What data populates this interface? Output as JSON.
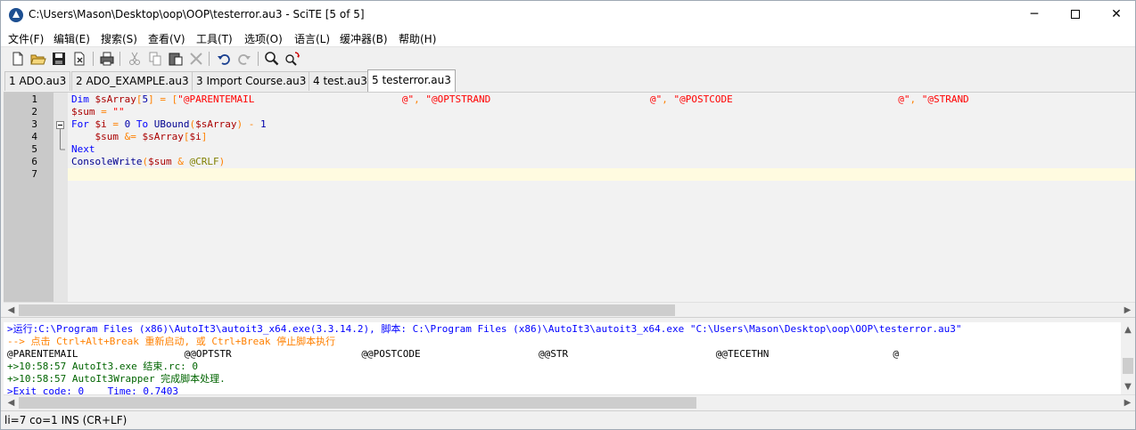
{
  "window": {
    "title": "C:\\Users\\Mason\\Desktop\\oop\\OOP\\testerror.au3 - SciTE [5 of 5]",
    "min_glyph": "─",
    "close_glyph": "✕"
  },
  "menu": [
    "文件(F)",
    "编辑(E)",
    "搜索(S)",
    "查看(V)",
    "工具(T)",
    "选项(O)",
    "语言(L)",
    "缓冲器(B)",
    "帮助(H)"
  ],
  "toolbar": {
    "icons": [
      "new-file-icon",
      "open-folder-icon",
      "save-icon",
      "close-file-icon",
      "print-icon",
      "cut-icon",
      "copy-icon",
      "paste-icon",
      "delete-icon",
      "undo-icon",
      "redo-icon",
      "find-icon",
      "replace-icon"
    ]
  },
  "tabs": [
    {
      "label": "1 ADO.au3",
      "active": false
    },
    {
      "label": "2 ADO_EXAMPLE.au3",
      "active": false
    },
    {
      "label": "3 Import Course.au3",
      "active": false
    },
    {
      "label": "4 test.au3",
      "active": false
    },
    {
      "label": "5 testerror.au3",
      "active": true
    }
  ],
  "editor": {
    "line_numbers": [
      "1",
      "2",
      "3",
      "4",
      "5",
      "6",
      "7"
    ],
    "lines": [
      [
        {
          "t": "Dim ",
          "c": "kw"
        },
        {
          "t": "$sArray",
          "c": "var"
        },
        {
          "t": "[",
          "c": "op"
        },
        {
          "t": "5",
          "c": "num"
        },
        {
          "t": "] = [",
          "c": "op"
        },
        {
          "t": "\"@PARENTEMAIL                         @\"",
          "c": "str"
        },
        {
          "t": ", ",
          "c": "op"
        },
        {
          "t": "\"@OPTSTRAND                           @\"",
          "c": "str"
        },
        {
          "t": ", ",
          "c": "op"
        },
        {
          "t": "\"@POSTCODE                            @\"",
          "c": "str"
        },
        {
          "t": ", ",
          "c": "op"
        },
        {
          "t": "\"@STRAND                              @\"",
          "c": "str"
        },
        {
          "t": ",",
          "c": "op"
        }
      ],
      [
        {
          "t": "$sum",
          "c": "var"
        },
        {
          "t": " = ",
          "c": "op"
        },
        {
          "t": "\"\"",
          "c": "str"
        }
      ],
      [
        {
          "t": "For ",
          "c": "kw"
        },
        {
          "t": "$i",
          "c": "var"
        },
        {
          "t": " = ",
          "c": "op"
        },
        {
          "t": "0",
          "c": "num"
        },
        {
          "t": " To ",
          "c": "kw"
        },
        {
          "t": "UBound",
          "c": "fn"
        },
        {
          "t": "(",
          "c": "op"
        },
        {
          "t": "$sArray",
          "c": "var"
        },
        {
          "t": ") - ",
          "c": "op"
        },
        {
          "t": "1",
          "c": "num"
        }
      ],
      [
        {
          "t": "    ",
          "c": "plain"
        },
        {
          "t": "$sum",
          "c": "var"
        },
        {
          "t": " &= ",
          "c": "op"
        },
        {
          "t": "$sArray",
          "c": "var"
        },
        {
          "t": "[",
          "c": "op"
        },
        {
          "t": "$i",
          "c": "var"
        },
        {
          "t": "]",
          "c": "op"
        }
      ],
      [
        {
          "t": "Next",
          "c": "kw"
        }
      ],
      [
        {
          "t": "ConsoleWrite",
          "c": "fn"
        },
        {
          "t": "(",
          "c": "op"
        },
        {
          "t": "$sum",
          "c": "var"
        },
        {
          "t": " & ",
          "c": "op"
        },
        {
          "t": "@CRLF",
          "c": "mac"
        },
        {
          "t": ")",
          "c": "op"
        }
      ],
      []
    ]
  },
  "output": [
    {
      "t": ">运行:C:\\Program Files (x86)\\AutoIt3\\autoit3_x64.exe(3.3.14.2), 脚本: C:\\Program Files (x86)\\AutoIt3\\autoit3_x64.exe \"C:\\Users\\Mason\\Desktop\\oop\\OOP\\testerror.au3\"",
      "c": "o-blue"
    },
    {
      "t": "--> 点击 Ctrl+Alt+Break 重新启动, 或 Ctrl+Break 停止脚本执行",
      "c": "o-orange"
    },
    {
      "t": "@PARENTEMAIL                  @@OPTSTR                      @@POSTCODE                    @@STR                         @@TECETHN                     @",
      "c": "o-black"
    },
    {
      "t": "+>10:58:57 AutoIt3.exe 结束.rc: 0",
      "c": "o-green"
    },
    {
      "t": "+>10:58:57 AutoIt3Wrapper 完成脚本处理.",
      "c": "o-green"
    },
    {
      "t": ">Exit code: 0    Time: 0.7403",
      "c": "o-blue"
    }
  ],
  "status": "li=7 co=1 INS (CR+LF)"
}
